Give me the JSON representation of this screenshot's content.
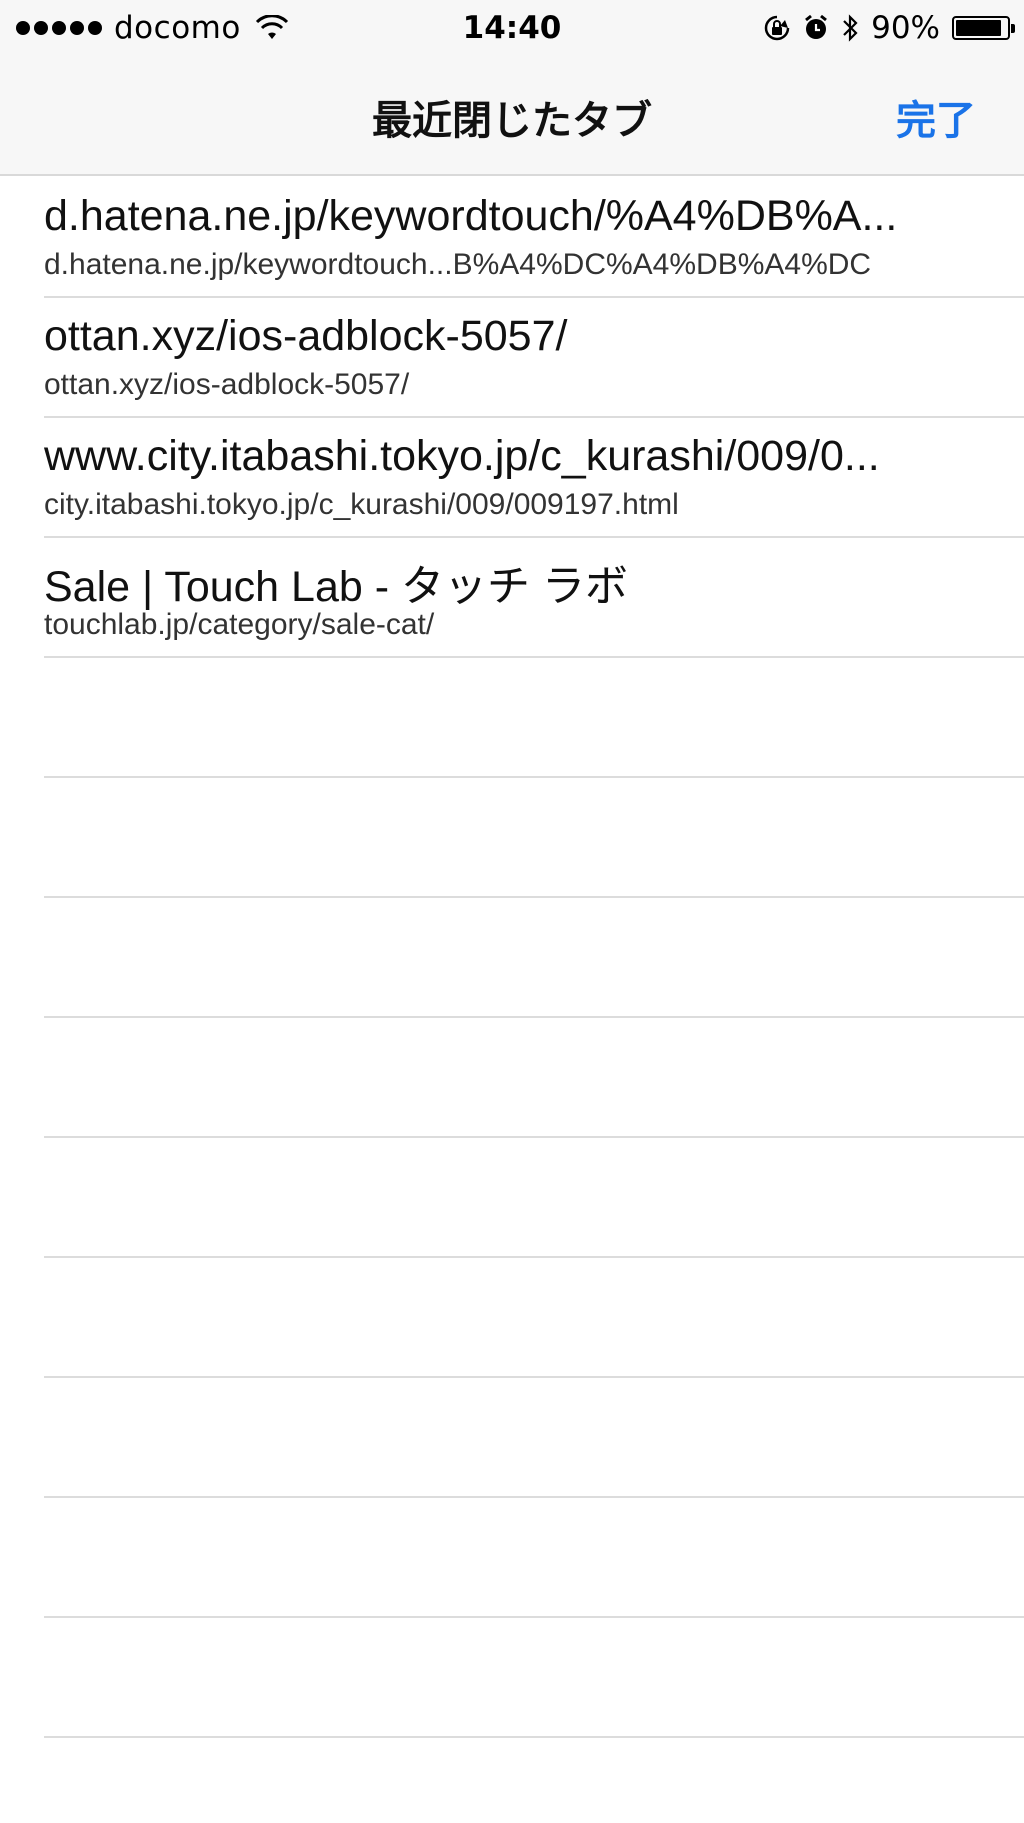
{
  "status_bar": {
    "carrier": "docomo",
    "time": "14:40",
    "battery_percent": "90%",
    "battery_level": 0.9,
    "icons": [
      "signal-dots-icon",
      "wifi-icon",
      "orientation-lock-icon",
      "alarm-icon",
      "bluetooth-icon",
      "battery-icon"
    ]
  },
  "nav": {
    "title": "最近閉じたタブ",
    "done_label": "完了",
    "accent_color": "#1a73e8"
  },
  "closed_tabs": [
    {
      "title": "d.hatena.ne.jp/keywordtouch/%A4%DB%A...",
      "url": "d.hatena.ne.jp/keywordtouch...B%A4%DC%A4%DB%A4%DC"
    },
    {
      "title": "ottan.xyz/ios-adblock-5057/",
      "url": "ottan.xyz/ios-adblock-5057/"
    },
    {
      "title": "www.city.itabashi.tokyo.jp/c_kurashi/009/0...",
      "url": "city.itabashi.tokyo.jp/c_kurashi/009/009197.html"
    },
    {
      "title": "Sale | Touch Lab - タッチ ラボ",
      "url": "touchlab.jp/category/sale-cat/"
    }
  ]
}
